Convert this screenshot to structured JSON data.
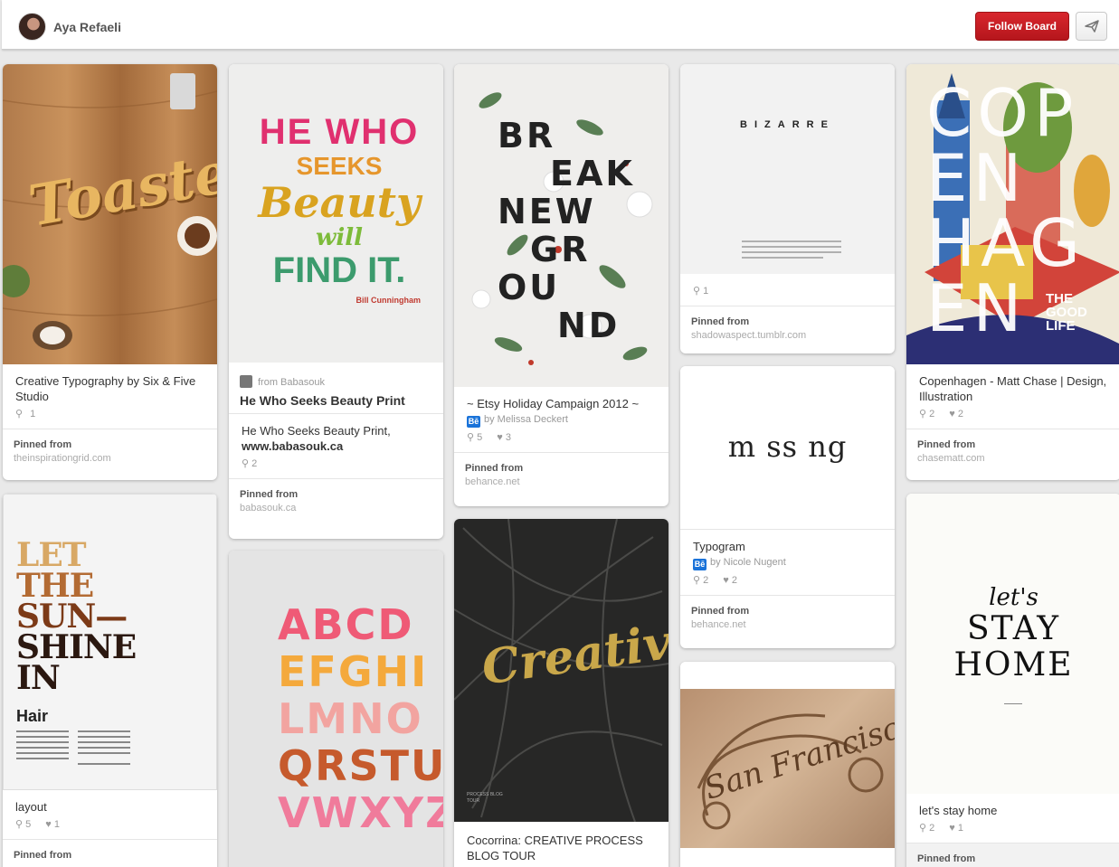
{
  "header": {
    "user_name": "Aya Refaeli",
    "follow_label": "Follow Board"
  },
  "pins": {
    "toasted": {
      "image_text": "Toasted",
      "description": "Creative Typography by Six & Five Studio",
      "repins": "1",
      "pinned_label": "Pinned from",
      "source": "theinspirationgrid.com"
    },
    "hewho": {
      "image_lines": [
        "HE WHO",
        "SEEKS",
        "Beauty",
        "will",
        "FIND IT.",
        "Bill Cunningham"
      ],
      "from": "from Babasouk",
      "title": "He Who Seeks Beauty Print",
      "description": "He Who Seeks Beauty Print, ",
      "description_bold": "www.babasouk.ca",
      "repins": "2",
      "pinned_label": "Pinned from",
      "source": "babasouk.ca"
    },
    "breaknew": {
      "image_lines": [
        "BR",
        "EAK",
        "NEW",
        "GR",
        "OU",
        "ND"
      ],
      "description": "~ Etsy Holiday Campaign 2012 ~",
      "by": "by Melissa Deckert",
      "repins": "5",
      "likes": "3",
      "pinned_label": "Pinned from",
      "source": "behance.net"
    },
    "bizarre": {
      "image_text": "BIZARRE",
      "repins": "1",
      "pinned_label": "Pinned from",
      "source": "shadowaspect.tumblr.com"
    },
    "copen": {
      "image_lines": [
        "COP",
        "EN",
        "HAG",
        "EN"
      ],
      "image_tagline": [
        "THE",
        "GOOD",
        "LIFE"
      ],
      "description": "Copenhagen - Matt Chase | Design, Illustration",
      "repins": "2",
      "likes": "2",
      "pinned_label": "Pinned from",
      "source": "chasematt.com"
    },
    "sunshine": {
      "image_lines": [
        "LET",
        "THE",
        "SUN—",
        "SHINE",
        "IN"
      ],
      "image_sub": "Hair",
      "description": "layout",
      "repins": "5",
      "likes": "1",
      "pinned_label": "Pinned from"
    },
    "abc": {
      "image_lines": [
        "ABCD",
        "EFGHI",
        "LMNO",
        "QRSTU",
        "VWXYZ"
      ]
    },
    "creative": {
      "image_text": "Creative",
      "image_caption": "PROCESS BLOG TOUR",
      "description": "Cocorrina: CREATIVE PROCESS BLOG TOUR"
    },
    "missing": {
      "image_text": "m ss ng",
      "description": "Typogram",
      "by": "by Nicole Nugent",
      "repins": "2",
      "likes": "2",
      "pinned_label": "Pinned from",
      "source": "behance.net"
    },
    "sanfran": {
      "image_text": "San Francisco"
    },
    "stayhome": {
      "image_lines": [
        "let's",
        "STAY",
        "HOME"
      ],
      "description": "let's stay home",
      "repins": "2",
      "likes": "1",
      "pinned_label": "Pinned from"
    }
  },
  "icons": {
    "repin": "pin-icon",
    "like": "heart-icon",
    "send": "send-icon",
    "behance": "Bē"
  },
  "colors": {
    "follow_red": "#c9191f",
    "background": "#e9e9e9"
  }
}
